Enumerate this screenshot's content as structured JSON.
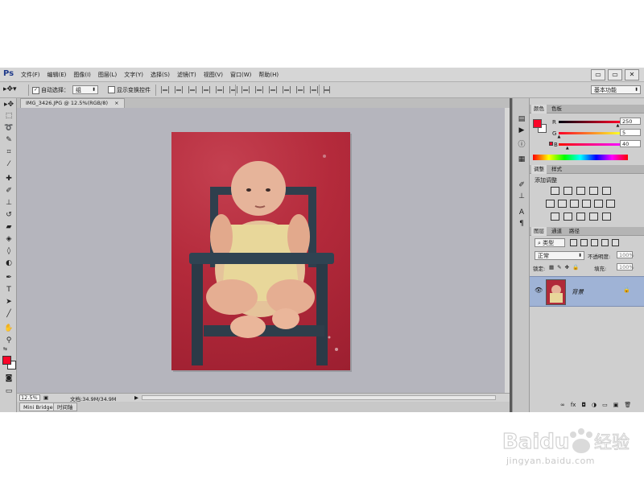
{
  "app": {
    "logo": "Ps",
    "menu": [
      "文件(F)",
      "编辑(E)",
      "图像(I)",
      "图层(L)",
      "文字(Y)",
      "选择(S)",
      "滤镜(T)",
      "视图(V)",
      "窗口(W)",
      "帮助(H)"
    ],
    "window_buttons": [
      "▭",
      "▭",
      "✕"
    ]
  },
  "options_bar": {
    "auto_select_label": "自动选择：",
    "auto_select_value": "组",
    "show_transform_label": "显示变换控件",
    "workspace": "基本功能"
  },
  "document": {
    "tab_title": "IMG_3426.JPG @ 12.5%(RGB/8)",
    "tab_close": "×",
    "zoom": "12.5%",
    "doc_size": "文档:34.9M/34.9M"
  },
  "bottom_tabs": [
    "Mini Bridge",
    "时间轴"
  ],
  "color_panel": {
    "tabs": [
      "颜色",
      "色板"
    ],
    "r_label": "R",
    "g_label": "G",
    "b_label": "B",
    "r": "250",
    "g": "5",
    "b": "40",
    "r_value": 250,
    "g_value": 5,
    "b_value": 40,
    "foreground": "#fa0528",
    "background": "#ffffff"
  },
  "adjust_panel": {
    "tabs": [
      "调整",
      "样式"
    ],
    "title": "添加调整"
  },
  "layers_panel": {
    "tabs": [
      "图层",
      "通道",
      "路径"
    ],
    "filter_type": "类型",
    "blend_mode": "正常",
    "opacity_label": "不透明度:",
    "opacity": "100%",
    "lock_label": "锁定:",
    "fill_label": "填充:",
    "fill": "100%",
    "layer_name": "背景"
  },
  "watermark": {
    "brand": "Baidu",
    "product": "经验",
    "url": "jingyan.baidu.com"
  }
}
